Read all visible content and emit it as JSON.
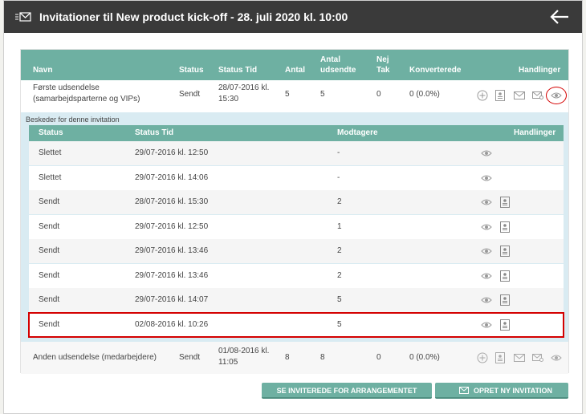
{
  "header": {
    "title": "Invitationer til New product kick-off - 28. juli 2020 kl. 10:00",
    "icon": "envelope-icon",
    "back_icon": "arrow-left-icon"
  },
  "table": {
    "headers": {
      "navn": "Navn",
      "status": "Status",
      "status_tid": "Status Tid",
      "antal": "Antal",
      "antal_udsendte_1": "Antal",
      "antal_udsendte_2": "udsendte",
      "nej_tak_1": "Nej",
      "nej_tak_2": "Tak",
      "konverterede": "Konverterede",
      "handlinger": "Handlinger"
    },
    "rows": [
      {
        "navn_1": "Første udsendelse",
        "navn_2": "(samarbejdsparterne og VIPs)",
        "status": "Sendt",
        "tid_1": "28/07-2016 kl.",
        "tid_2": "15:30",
        "antal": "5",
        "udsendte": "5",
        "nej_tak": "0",
        "konverterede": "0 (0.0%)"
      },
      {
        "navn_1": "Anden udsendelse (medarbejdere)",
        "status": "Sendt",
        "tid_1": "01/08-2016 kl.",
        "tid_2": "11:05",
        "antal": "8",
        "udsendte": "8",
        "nej_tak": "0",
        "konverterede": "0 (0.0%)"
      }
    ]
  },
  "messages": {
    "caption": "Beskeder for denne invitation",
    "headers": {
      "status": "Status",
      "status_tid": "Status Tid",
      "modtagere": "Modtagere",
      "handlinger": "Handlinger"
    },
    "rows": [
      {
        "status": "Slettet",
        "tid": "29/07-2016 kl. 12:50",
        "modtagere": "-"
      },
      {
        "status": "Slettet",
        "tid": "29/07-2016 kl. 14:06",
        "modtagere": "-"
      },
      {
        "status": "Sendt",
        "tid": "28/07-2016 kl. 15:30",
        "modtagere": "2"
      },
      {
        "status": "Sendt",
        "tid": "29/07-2016 kl. 12:50",
        "modtagere": "1"
      },
      {
        "status": "Sendt",
        "tid": "29/07-2016 kl. 13:46",
        "modtagere": "2"
      },
      {
        "status": "Sendt",
        "tid": "29/07-2016 kl. 13:46",
        "modtagere": "2"
      },
      {
        "status": "Sendt",
        "tid": "29/07-2016 kl. 14:07",
        "modtagere": "5"
      },
      {
        "status": "Sendt",
        "tid": "02/08-2016 kl. 10:26",
        "modtagere": "5"
      }
    ]
  },
  "buttons": {
    "se_inviterede": "SE INVITEREDE FOR ARRANGEMENTET",
    "opret": "OPRET NY INVITATION"
  },
  "colors": {
    "header_bg": "#3a3a3a",
    "accent": "#6eb0a2",
    "sub_bg": "#d9ebf2",
    "highlight": "#d40000"
  }
}
